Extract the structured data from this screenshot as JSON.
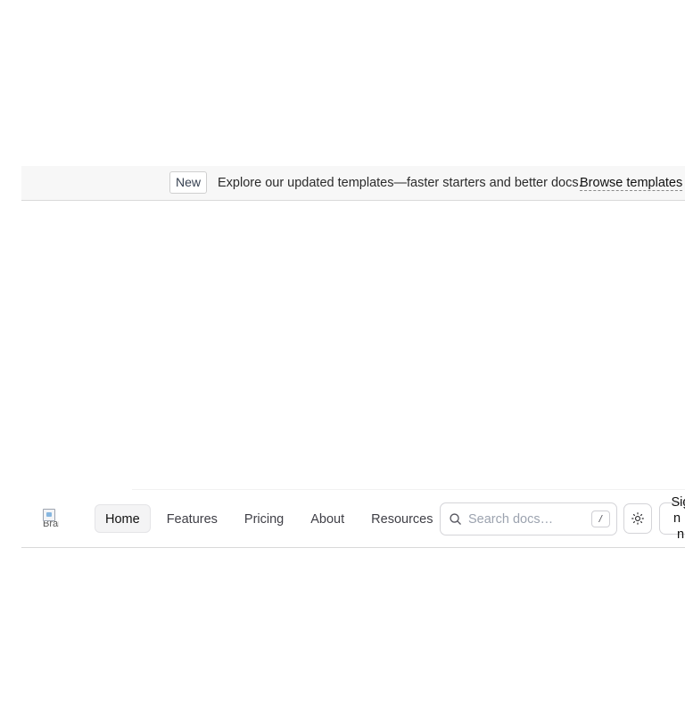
{
  "announcement": {
    "badge": "New",
    "text": "Explore our updated templates—faster starters and better docs.",
    "link": "Browse templates"
  },
  "nav": {
    "logo_alt": "Brand",
    "items": [
      {
        "label": "Home",
        "active": true
      },
      {
        "label": "Features",
        "active": false
      },
      {
        "label": "Pricing",
        "active": false
      },
      {
        "label": "About",
        "active": false
      },
      {
        "label": "Resources",
        "active": false
      }
    ],
    "search": {
      "placeholder": "Search docs…",
      "shortcut": "/",
      "icon": "search-icon"
    },
    "theme_toggle_icon": "sun-icon",
    "signin_label": "Sign In"
  }
}
